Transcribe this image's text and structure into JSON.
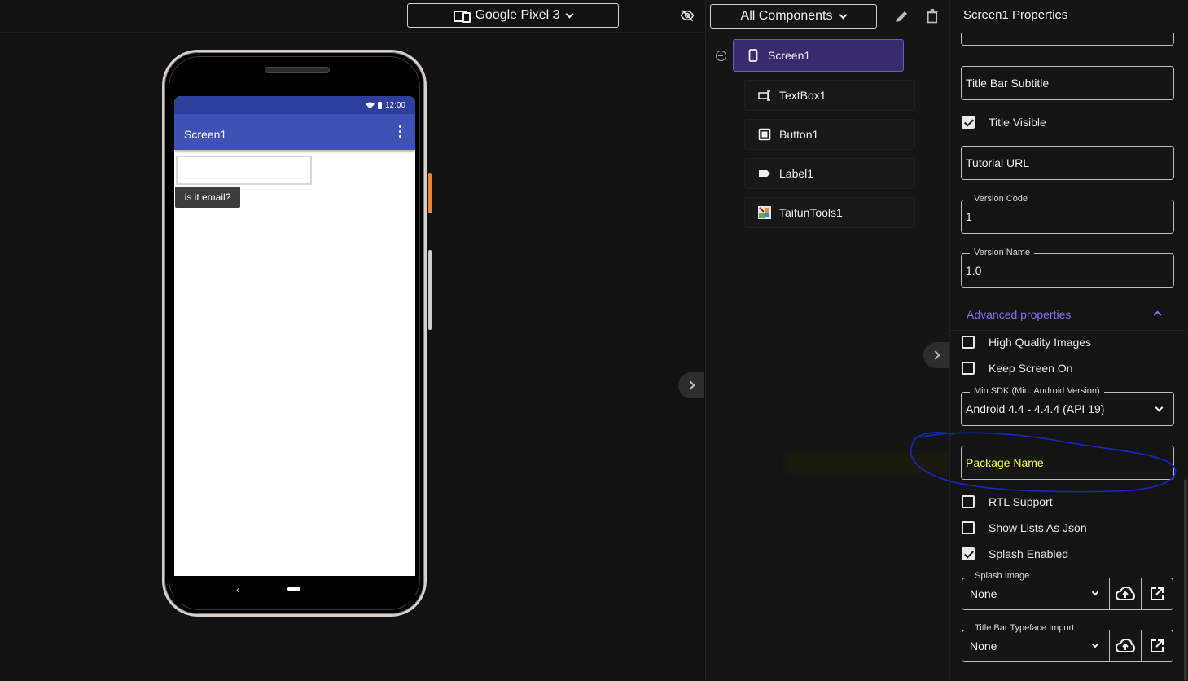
{
  "viewer": {
    "device_label": "Google Pixel 3",
    "phone": {
      "status_time": "12:00",
      "screen_title": "Screen1",
      "button_text": "is it email?",
      "back_glyph": "‹"
    }
  },
  "components": {
    "filter_label": "All Components",
    "tree": [
      {
        "label": "Screen1",
        "icon": "phone-icon",
        "selected": true
      },
      {
        "label": "TextBox1",
        "icon": "textbox-icon"
      },
      {
        "label": "Button1",
        "icon": "button-icon"
      },
      {
        "label": "Label1",
        "icon": "label-icon"
      },
      {
        "label": "TaifunTools1",
        "icon": "extension-icon"
      }
    ]
  },
  "properties": {
    "title": "Screen1 Properties",
    "title_bar_subtitle": "Title Bar Subtitle",
    "title_visible": "Title Visible",
    "tutorial_url": "Tutorial URL",
    "version_code_label": "Version Code",
    "version_code_value": "1",
    "version_name_label": "Version Name",
    "version_name_value": "1.0",
    "advanced_label": "Advanced properties",
    "high_quality_images": "High Quality Images",
    "keep_screen_on": "Keep Screen On",
    "min_sdk_label": "Min SDK (Min. Android Version)",
    "min_sdk_value": "Android 4.4 - 4.4.4 (API 19)",
    "package_name": "Package Name",
    "rtl_support": "RTL Support",
    "show_lists_as_json": "Show Lists As Json",
    "splash_enabled": "Splash Enabled",
    "splash_image_label": "Splash Image",
    "splash_image_value": "None",
    "title_bar_typeface_label": "Title Bar Typeface Import",
    "title_bar_typeface_value": "None"
  },
  "colors": {
    "accent": "#8a6cf0",
    "selected_bg": "#3a2a6e",
    "appbar": "#3f51b5",
    "highlight_text": "#ffff3c",
    "annotation_stroke": "#1428c8"
  }
}
